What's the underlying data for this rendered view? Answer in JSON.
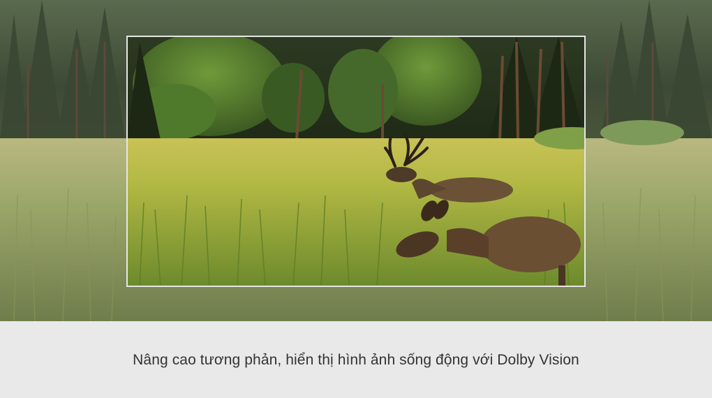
{
  "caption": {
    "text": "Nâng cao tương phản, hiển thị hình ảnh sống động với Dolby Vision"
  },
  "colors": {
    "caption_band": "#e9e9e9",
    "caption_text": "#333333",
    "frame_outline": "#e6e6e6"
  },
  "photo": {
    "subject_icons": [
      "forest-background",
      "meadow-grass",
      "stag-deer",
      "doe-deer"
    ]
  }
}
